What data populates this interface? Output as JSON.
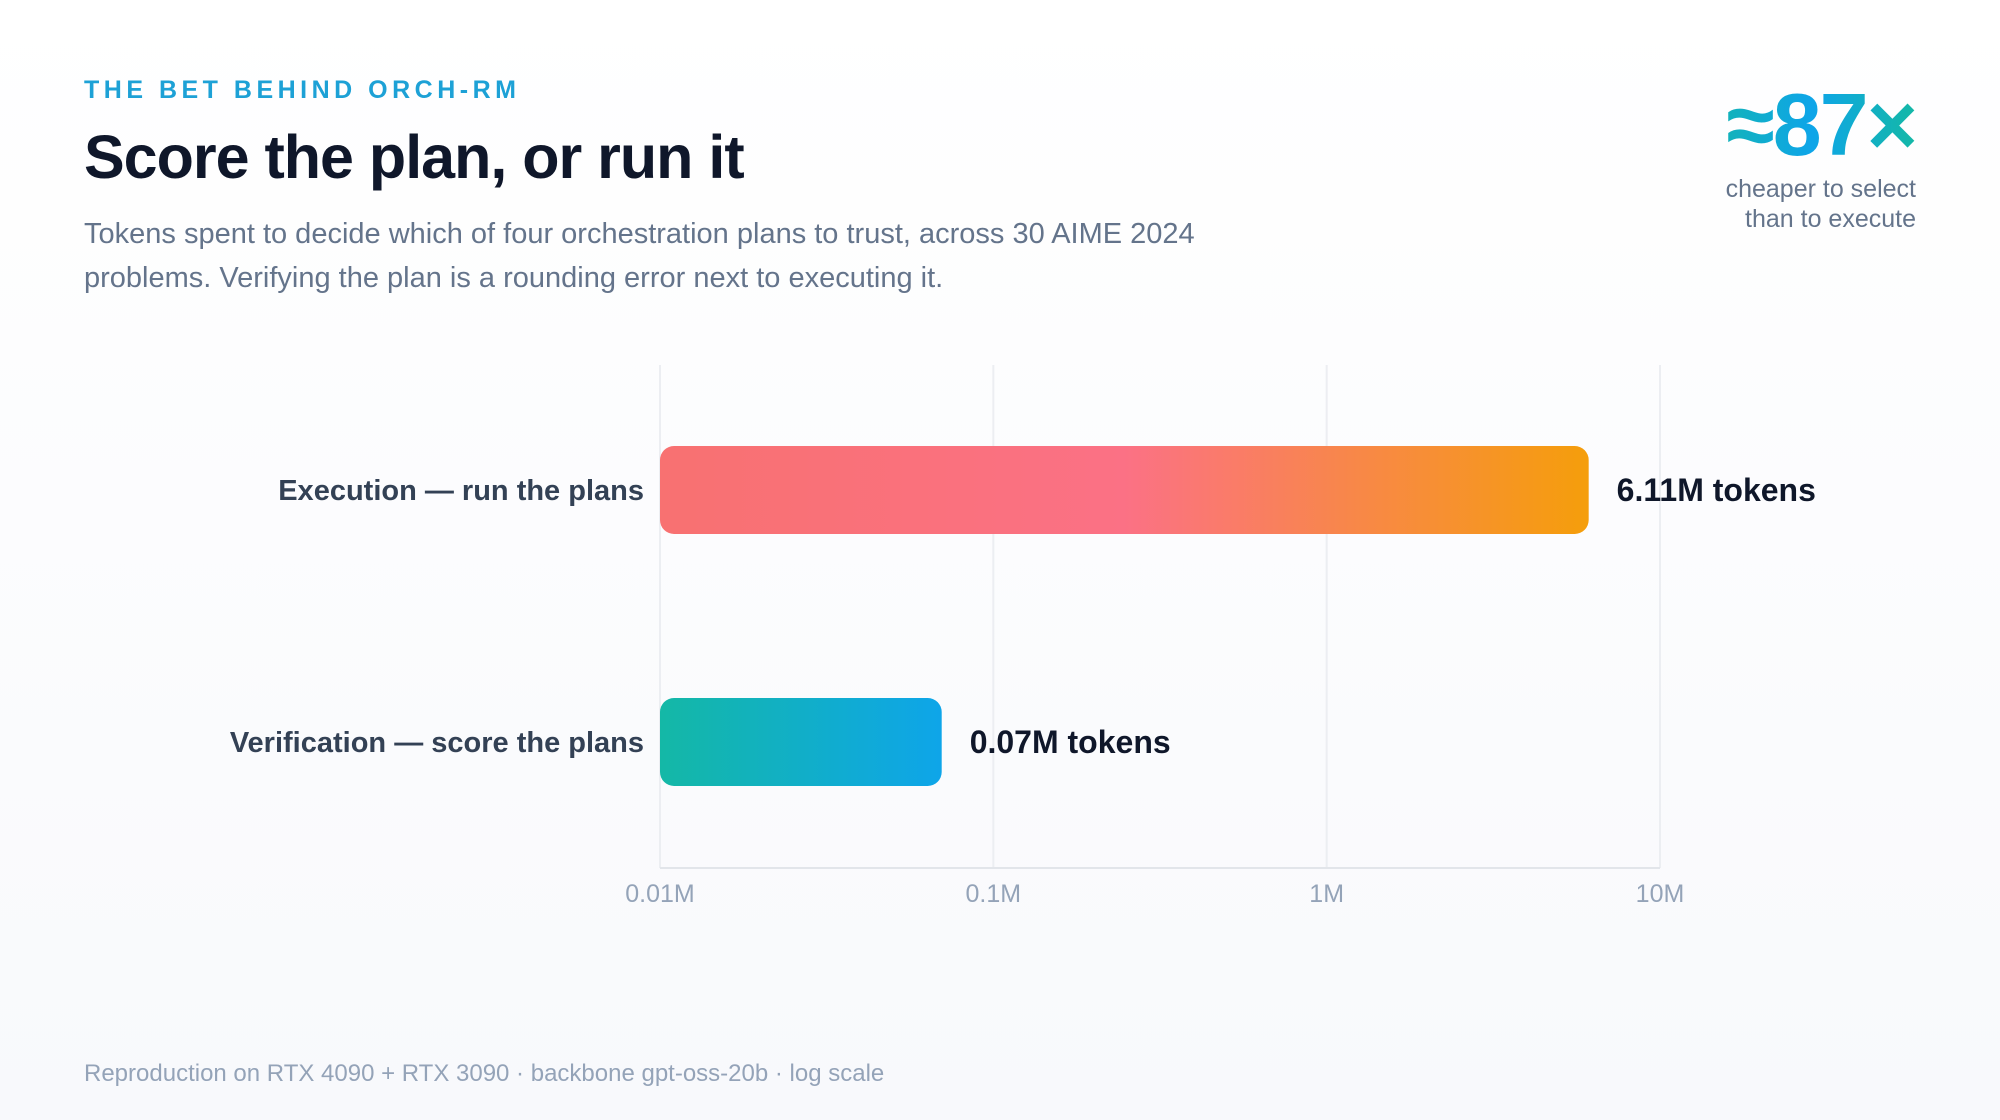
{
  "header": {
    "eyebrow": "THE BET BEHIND ORCH-RM",
    "title": "Score the plan, or run it",
    "subtitle": "Tokens spent to decide which of four orchestration plans to trust, across 30 AIME 2024 problems. Verifying the plan is a rounding error next to executing it."
  },
  "stat": {
    "value": "≈87×",
    "caption": "cheaper to select than to execute"
  },
  "footer": {
    "note": "Reproduction on RTX 4090 + RTX 3090 · backbone gpt-oss-20b · log scale"
  },
  "chart_data": {
    "type": "bar",
    "orientation": "horizontal",
    "scale": "log",
    "xlim": [
      0.01,
      10
    ],
    "x_unit": "M tokens",
    "ticks": [
      {
        "value": 0.01,
        "label": "0.01M"
      },
      {
        "value": 0.1,
        "label": "0.1M"
      },
      {
        "value": 1,
        "label": "1M"
      },
      {
        "value": 10,
        "label": "10M"
      }
    ],
    "grid": true,
    "bars": [
      {
        "category": "Execution — run the plans",
        "value": 6.11,
        "value_label": "6.11M tokens",
        "colors": [
          "#f87171",
          "#fb7185",
          "#f59e0b"
        ]
      },
      {
        "category": "Verification — score the plans",
        "value": 0.07,
        "value_label": "0.07M tokens",
        "colors": [
          "#14b8a6",
          "#0ea5e9"
        ]
      }
    ]
  }
}
